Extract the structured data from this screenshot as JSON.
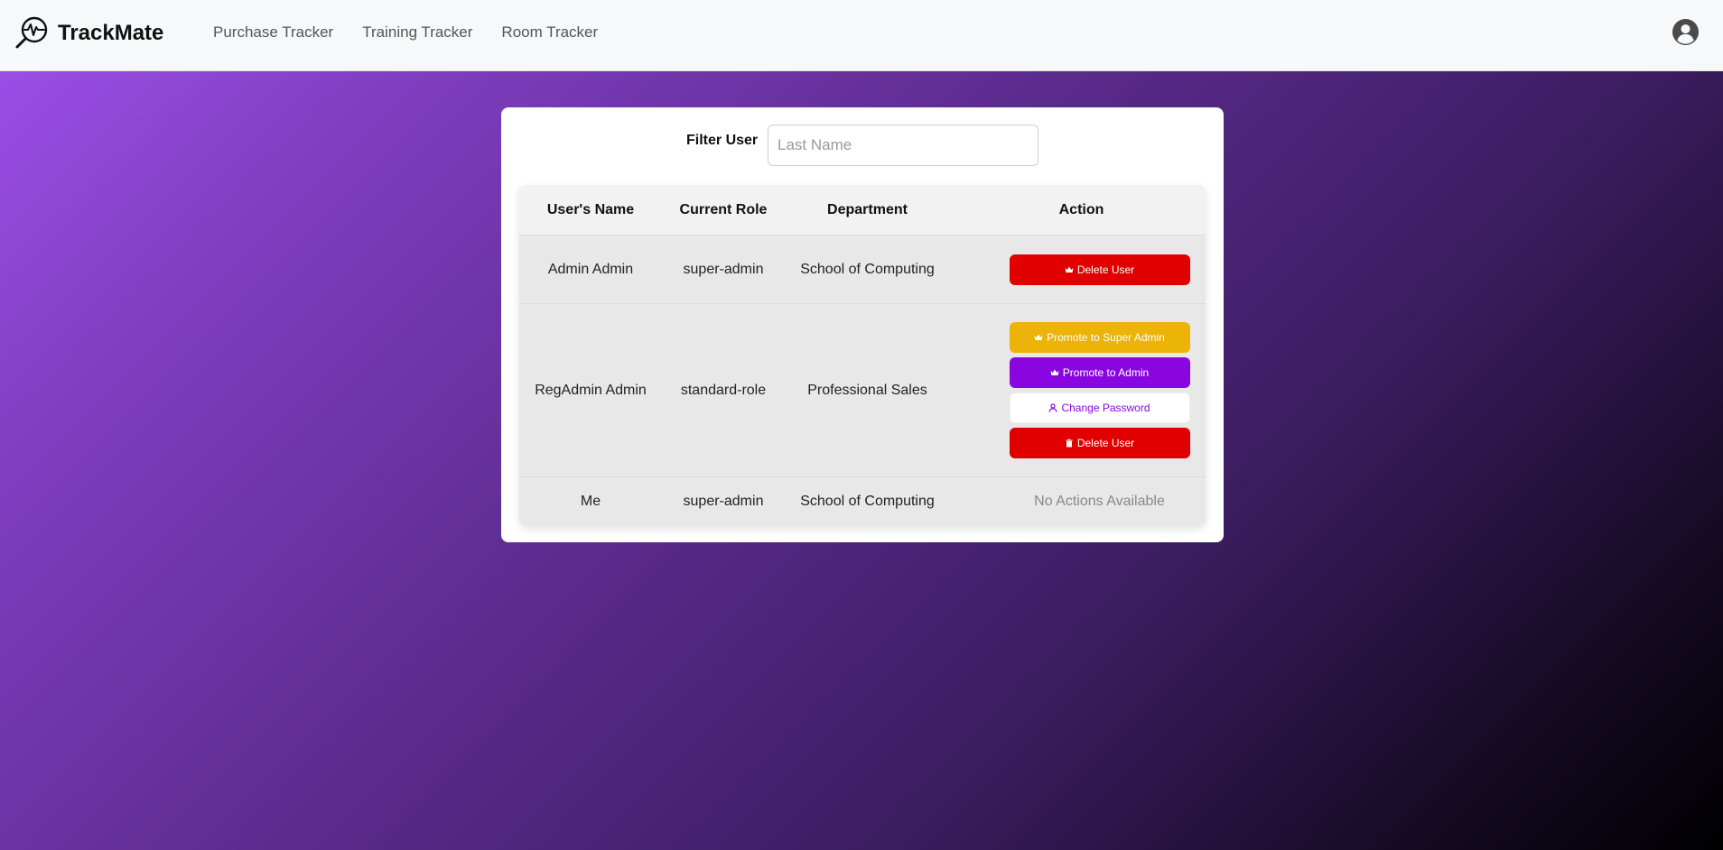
{
  "app": {
    "name": "TrackMate",
    "logo_icon": "heartbeat-magnifier-icon"
  },
  "nav": {
    "items": [
      {
        "label": "Purchase Tracker"
      },
      {
        "label": "Training Tracker"
      },
      {
        "label": "Room Tracker"
      }
    ]
  },
  "profile": {
    "icon": "user-circle-icon"
  },
  "filter": {
    "label": "Filter User",
    "placeholder": "Last Name",
    "value": ""
  },
  "table": {
    "headers": [
      "User's Name",
      "Current Role",
      "Department",
      "Action"
    ],
    "rows": [
      {
        "name": "Admin Admin",
        "role": "super-admin",
        "department": "School of Computing",
        "actions": [
          {
            "label": "Delete User",
            "icon": "crown-icon",
            "color": "#e00000"
          }
        ]
      },
      {
        "name": "RegAdmin Admin",
        "role": "standard-role",
        "department": "Professional Sales",
        "actions": [
          {
            "label": "Promote to Super Admin",
            "icon": "crown-icon",
            "color": "#ecb309"
          },
          {
            "label": "Promote to Admin",
            "icon": "crown-icon",
            "color": "#8a06e0"
          },
          {
            "label": "Change Password",
            "icon": "user-key-icon",
            "color": "#ffffff"
          },
          {
            "label": "Delete User",
            "icon": "trash-icon",
            "color": "#e00000"
          }
        ]
      },
      {
        "name": "Me",
        "role": "super-admin",
        "department": "School of Computing",
        "no_actions": "No Actions Available"
      }
    ]
  },
  "colors": {
    "delete": "#e00000",
    "promote_super": "#ecb309",
    "promote_admin": "#8a06e0",
    "accent": "#8a06e0"
  }
}
